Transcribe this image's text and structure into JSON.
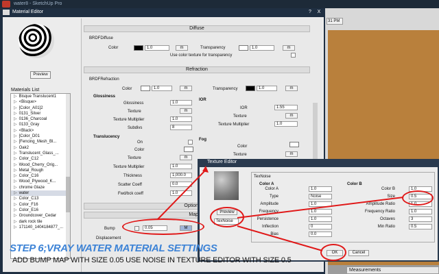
{
  "app": {
    "title": "water8 - SketchUp Pro",
    "time_fragment": "31 PM",
    "measurements_label": "Measurements"
  },
  "editor": {
    "title": "Material Editor",
    "help_button": "?",
    "close_button": "X",
    "preview_button": "Preview",
    "materials_list_label": "Materials List",
    "materials": [
      "Bisque Translucent1",
      "<Bisque>",
      "[Color_A01]2",
      "0131_Silver",
      "0136_Charcoal",
      "0133_Gray",
      "<Black>",
      "[Color_D01",
      "[Fencing_Mesh_Bl...",
      "Oak2",
      "Translucent_Glass_...",
      "Color_C12",
      "Wood_Cherry_Orig...",
      "Metal_Rough",
      "Color_C16",
      "Wood_Plywood_K...",
      "chrome Glaze",
      "water",
      "Color_C13",
      "Color_F16",
      "Color_E16",
      "Groundcover_Cedar",
      "dark rock tile",
      "171140_1404184877_..."
    ],
    "selected_material": "water"
  },
  "diffuse": {
    "section_title": "Diffuse",
    "brdf_label": "BRDFDiffuse",
    "color_label": "Color",
    "color_value": "1.0",
    "m_label": "m",
    "transparency_label": "Transparency",
    "transparency_value": "1.0",
    "use_color_texture_label": "Use color texture for transparency"
  },
  "refraction": {
    "section_title": "Refraction",
    "brdf_label": "BRDFRefraction",
    "color_label": "Color",
    "color_value": "1.0",
    "transparency_label": "Transparency",
    "transparency_value": "1.0",
    "glossiness_label": "Glossiness",
    "gloss_glossiness_label": "Glossiness",
    "gloss_glossiness_value": "1.0",
    "texture_label": "Texture",
    "texture_multiplier_label": "Texture Multiplier",
    "texture_multiplier_value": "1.0",
    "subdivs_label": "Subdivs",
    "subdivs_value": "8",
    "ior_group_label": "IOR",
    "ior_label": "IOR",
    "ior_value": "1.55",
    "ior_texture_label": "Texture",
    "ior_texture_multiplier_label": "Texture Multiplier",
    "ior_texture_multiplier_value": "1.0",
    "translucency_label": "Translucency",
    "on_label": "On",
    "trans_color_label": "Color",
    "trans_texture_label": "Texture",
    "trans_texture_multiplier_label": "Texture Multiplier",
    "trans_texture_multiplier_value": "1.0",
    "thickness_label": "Thickness",
    "thickness_value": "1,000.0",
    "scatter_coeff_label": "Scatter Coeff",
    "scatter_coeff_value": "0.0",
    "fwd_bck_coeff_label": "Fwd/bck coeff",
    "fwd_bck_coeff_value": "1.0",
    "fog_label": "Fog",
    "fog_color_label": "Color",
    "fog_texture_label": "Texture"
  },
  "options": {
    "section_title": "Option"
  },
  "maps": {
    "section_title": "Map",
    "bump_label": "Bump",
    "bump_value": "0.05",
    "bump_m": "M",
    "displacement_label": "Displacement"
  },
  "texture_editor": {
    "title": "Texture Editor",
    "preview_button": "Preview",
    "type_select": "TexNoise",
    "group_title": "TexNoise",
    "color_a_label": "Color A",
    "color_b_label": "Color B",
    "left_rows": [
      {
        "label": "Color A",
        "value": "1.0"
      },
      {
        "label": "Type",
        "value": "Noise"
      },
      {
        "label": "Amplitude",
        "value": "1.0"
      },
      {
        "label": "Frequency",
        "value": "1.0"
      },
      {
        "label": "Persistence",
        "value": "1.0"
      },
      {
        "label": "Inflection",
        "value": "0"
      },
      {
        "label": "Bias",
        "value": "0.0"
      }
    ],
    "right_rows": [
      {
        "label": "Color B",
        "value": "1.0"
      },
      {
        "label": "Size",
        "value": "0.5"
      },
      {
        "label": "Amplitude Ratio",
        "value": "1.0"
      },
      {
        "label": "Frequency Ratio",
        "value": "1.0"
      },
      {
        "label": "Octaves",
        "value": "3"
      },
      {
        "label": "Min Ratio",
        "value": "0.5"
      }
    ],
    "ok_label": "OK",
    "cancel_label": "Cancel"
  },
  "captions": {
    "step": "STEP 6;VRAY WATER MATERIAL SETTINGS",
    "instruction": "ADD BUMP MAP WITH SIZE 0.05 USE NOISE IN TEXTURE EDITOR WITH SIZE 0.5"
  },
  "colors": {
    "annotation_red": "#e01818",
    "caption_blue": "#3d83d6",
    "water_brown": "#b9803c"
  }
}
